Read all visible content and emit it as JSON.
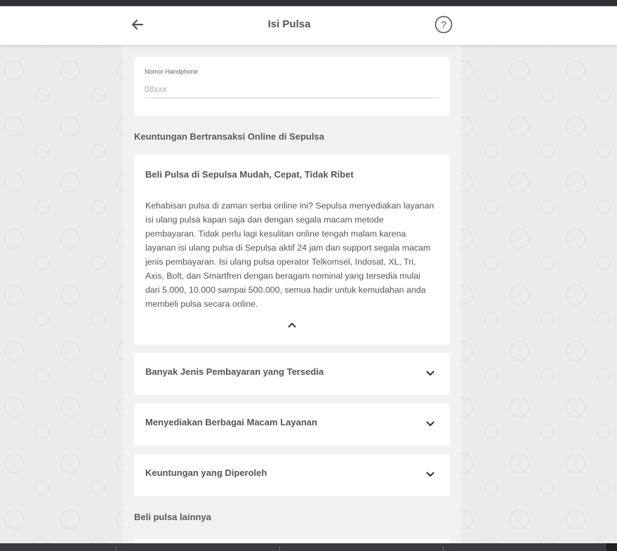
{
  "header": {
    "title": "Isi Pulsa",
    "back_icon": "arrow-left-icon",
    "help_icon": "question-circle-icon"
  },
  "phone": {
    "label": "Nomor Handphone",
    "placeholder": "08xxx",
    "value": ""
  },
  "benefits": {
    "section_title": "Keuntungan Bertransaksi Online di Sepulsa",
    "open_item": {
      "title": "Beli Pulsa di Sepulsa Mudah, Cepat, Tidak Ribet",
      "body": "Kehabisan pulsa di zaman serba online ini? Sepulsa menyediakan layanan isi ulang pulsa kapan saja dan dengan segala macam metode pembayaran. Tidak perlu lagi kesulitan online tengah malam karena layanan isi ulang pulsa di Sepulsa aktif 24 jam dan support segala macam jenis pembayaran. Isi ulang pulsa operator Telkomsel, Indosat, XL, Tri, Axis, Bolt, dan Smartfren dengan beragam nominal yang tersedia mulai dari 5.000, 10.000 sampai 500.000, semua hadir untuk kemudahan anda membeli pulsa secara online."
    },
    "items": [
      {
        "title": "Banyak Jenis Pembayaran yang Tersedia"
      },
      {
        "title": "Menyediakan Berbagai Macam Layanan"
      },
      {
        "title": "Keuntungan yang Diperoleh"
      }
    ]
  },
  "other": {
    "section_title": "Beli pulsa lainnya"
  },
  "colors": {
    "header_bg": "#ffffff",
    "text": "#555555",
    "page_bg": "#ebebeb",
    "column_bg": "#f1f1f1"
  }
}
